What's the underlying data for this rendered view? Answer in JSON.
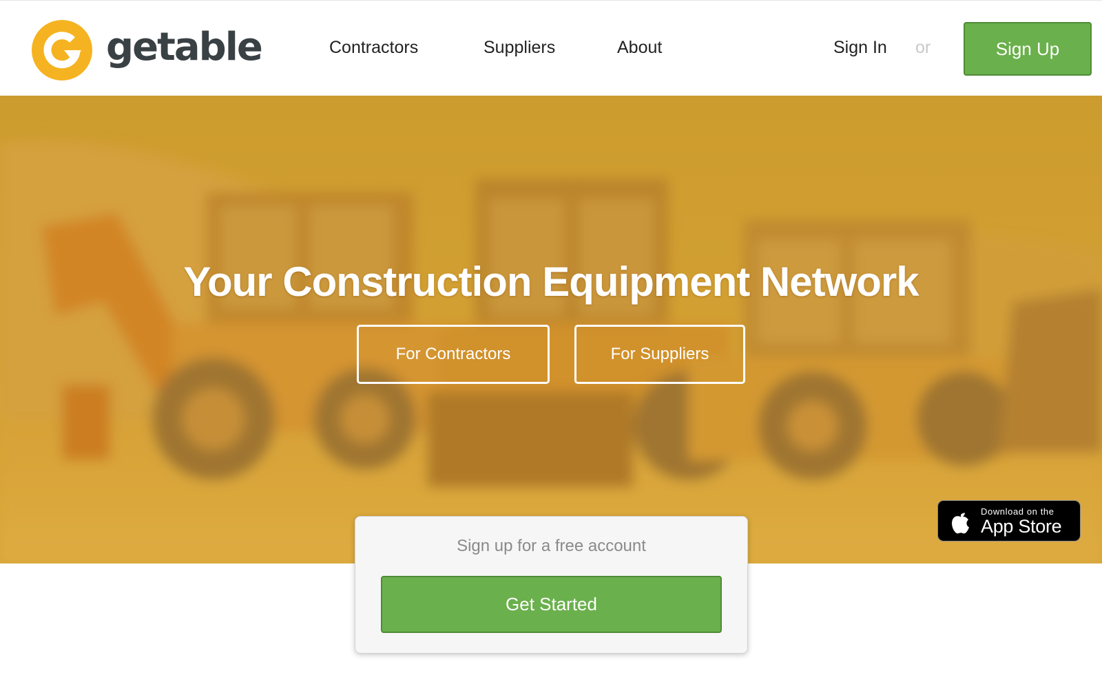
{
  "header": {
    "logo_text": "getable",
    "nav": {
      "contractors": "Contractors",
      "suppliers": "Suppliers",
      "about": "About"
    },
    "sign_in": "Sign In",
    "or": "or",
    "sign_up": "Sign Up"
  },
  "hero": {
    "title": "Your Construction Equipment Network",
    "for_contractors": "For Contractors",
    "for_suppliers": "For Suppliers"
  },
  "app_store": {
    "small_text": "Download on the",
    "large_text": "App Store",
    "icon": "apple-icon"
  },
  "signup_card": {
    "heading": "Sign up for a free account",
    "button": "Get Started"
  },
  "colors": {
    "brand_yellow": "#f5b321",
    "brand_dark": "#3a4145",
    "green": "#6ab04c",
    "green_border": "#4f8b37",
    "hero_tint": "#d29a33"
  }
}
